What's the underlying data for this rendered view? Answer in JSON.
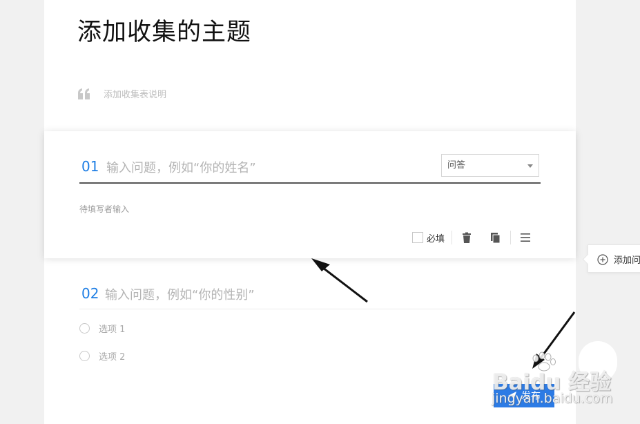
{
  "form": {
    "title": "添加收集的主题",
    "description_placeholder": "添加收集表说明"
  },
  "question1": {
    "number": "01",
    "placeholder": "输入问题，例如“你的姓名”",
    "type_selected": "问答",
    "answer_hint": "待填写者输入",
    "required_label": "必填"
  },
  "toolbar": {
    "icons": [
      "checkbox",
      "trash-icon",
      "copy-icon",
      "menu-icon"
    ]
  },
  "question2": {
    "number": "02",
    "placeholder": "输入问题，例如“你的性别”",
    "options": [
      "选项 1",
      "选项 2"
    ]
  },
  "side_panel": {
    "add_label": "添加问"
  },
  "publish_label": "发布",
  "watermark": {
    "main": "Baidu 经验",
    "sub": "jingyan.baidu.com"
  },
  "colors": {
    "accent": "#1e7ee4",
    "publish_bg": "#2c7be5",
    "page_bg": "#f1f1f1"
  }
}
